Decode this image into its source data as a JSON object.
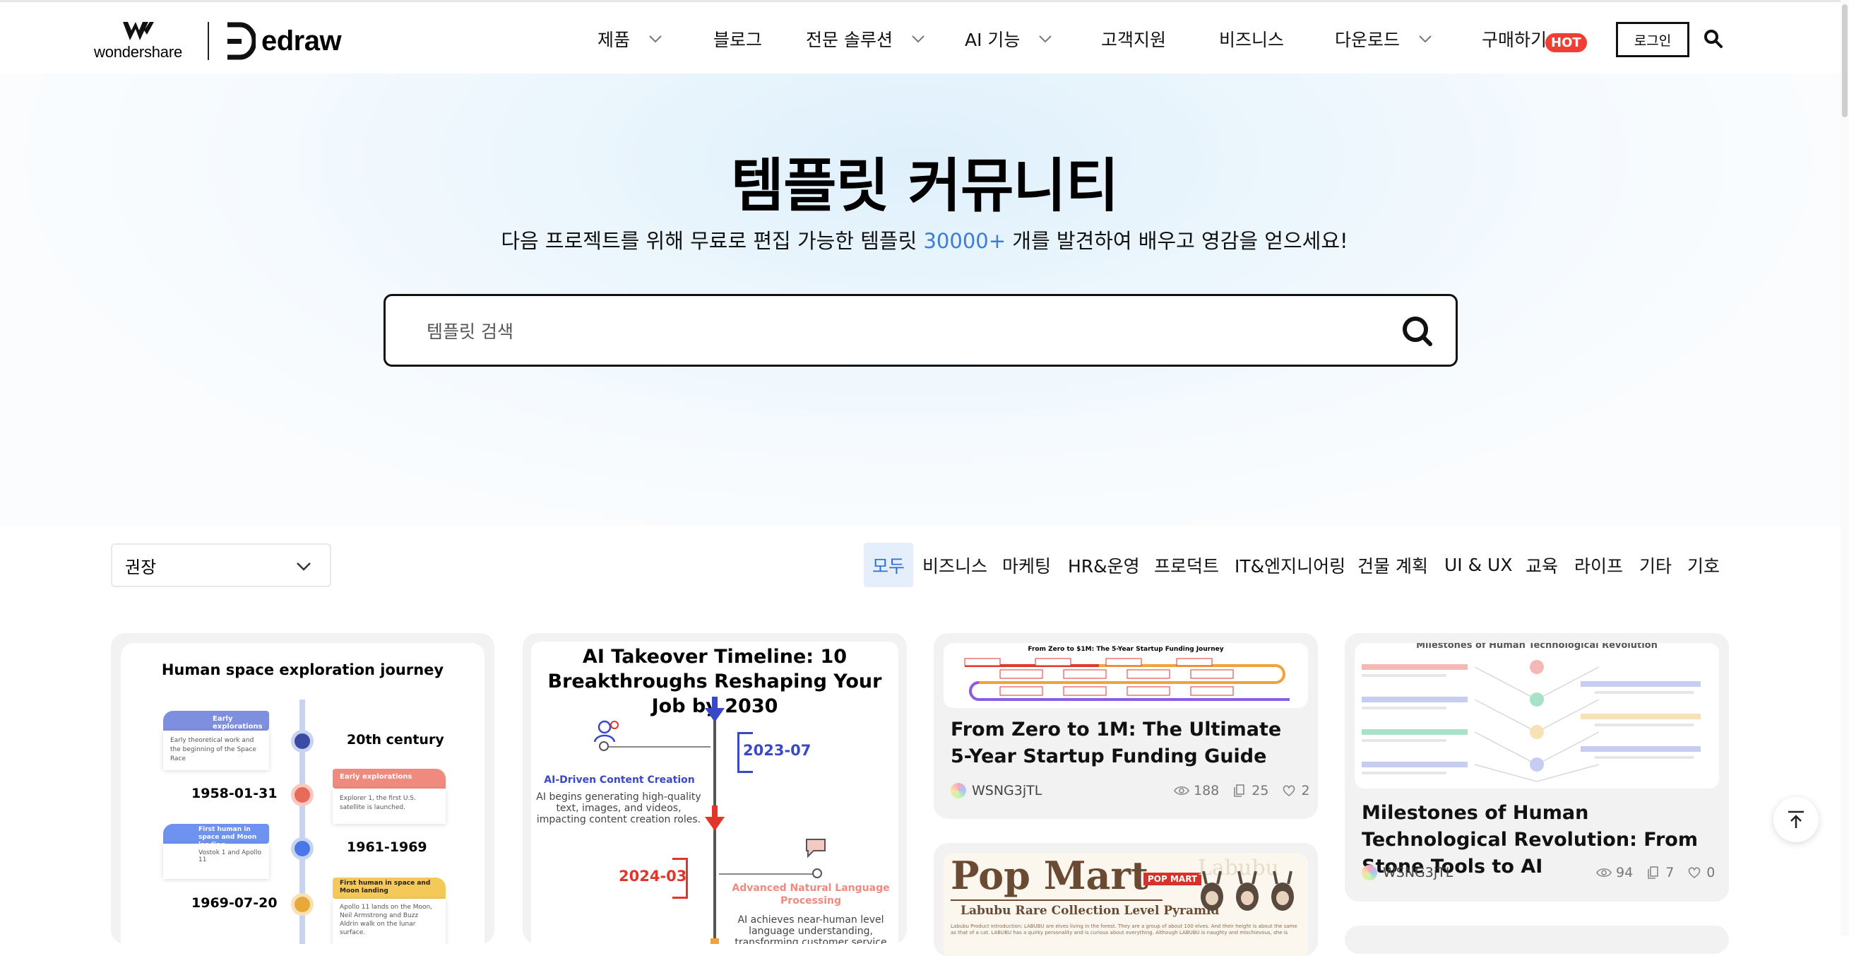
{
  "brand": {
    "wondershare": "wondershare",
    "edraw": "edraw"
  },
  "nav": {
    "items": [
      {
        "label": "제품",
        "dropdown": true
      },
      {
        "label": "블로그",
        "dropdown": false
      },
      {
        "label": "전문 솔루션",
        "dropdown": true
      },
      {
        "label": "AI 기능",
        "dropdown": true
      },
      {
        "label": "고객지원",
        "dropdown": false
      },
      {
        "label": "비즈니스",
        "dropdown": false
      },
      {
        "label": "다운로드",
        "dropdown": true
      },
      {
        "label": "구매하기",
        "dropdown": false
      }
    ],
    "hot_badge": "HOT",
    "login": "로그인"
  },
  "hero": {
    "title": "템플릿 커뮤니티",
    "subtitle_before": "다음 프로젝트를 위해 무료로 편집 가능한 템플릿 ",
    "subtitle_count": "30000+",
    "subtitle_after": " 개를 발견하여 배우고 영감을 얻으세요!",
    "search_placeholder": "템플릿 검색"
  },
  "sort": {
    "selected": "권장"
  },
  "tabs": [
    "모두",
    "비즈니스",
    "마케팅",
    "HR&운영",
    "프로덕트",
    "IT&엔지니어링",
    "건물 계획",
    "UI & UX",
    "교육",
    "라이프",
    "기타",
    "기호"
  ],
  "cards": [
    {
      "thumb": {
        "title": "Human space exploration journey",
        "events": [
          {
            "date": "20th century",
            "label": "Early explorations",
            "desc": "Early theoretical work and the beginning of the Space Race"
          },
          {
            "date": "1958-01-31",
            "label": "Early explorations",
            "desc": "Explorer 1, the first U.S. satellite is launched."
          },
          {
            "date": "1961-1969",
            "label": "First human in space and Moon landing",
            "desc": "Vostok 1 and Apollo 11"
          },
          {
            "date": "1969-07-20",
            "label": "First human in space and Moon landing",
            "desc": "Apollo 11 lands on the Moon, Neil Armstrong and Buzz Aldrin walk on the lunar surface."
          }
        ]
      }
    },
    {
      "thumb": {
        "title": "AI Takeover Timeline: 10 Breakthroughs Reshaping Your Job by 2030",
        "d1": "2023-07",
        "h1": "AI-Driven Content Creation",
        "p1": "AI begins generating high-quality text, images, and videos, impacting content creation roles.",
        "d2": "2024-03",
        "h2": "Advanced Natural Language Processing",
        "p2": "AI achieves near-human level language understanding, transforming customer service"
      }
    },
    {
      "title": "From Zero to 1M: The Ultimate 5-Year Startup Funding Guide",
      "author": "WSNG3jTL",
      "views": "188",
      "copies": "25",
      "likes": "2",
      "thumb": {
        "title": "From Zero to $1M: The 5-Year Startup Funding Journey"
      }
    },
    {
      "thumb": {
        "brand": "Pop Mart",
        "sub": "Labubu Rare Collection Level Pyramid",
        "tag": "POP MART",
        "corner": "Labubu",
        "desc": "Labubu Product Introduction: LABUBU are elves living in the forest. They are a group of about 100 elves. And their height is about the same as that of a cat. LABUBU has a quirky personality and is curious about everything. Although LABUBU is naughty and mischievous, she is"
      }
    },
    {
      "title": "Milestones of Human Technological Revolution: From Stone Tools to AI",
      "author": "WSNG3jTL",
      "views": "94",
      "copies": "7",
      "likes": "0",
      "thumb": {
        "title": "Milestones of Human Technological Revolution"
      }
    }
  ],
  "colors": {
    "accent": "#3b7dd8",
    "hot": "#ef3f34",
    "tab_active_bg": "#e5eefb",
    "card_bg": "#f2f2f2"
  }
}
